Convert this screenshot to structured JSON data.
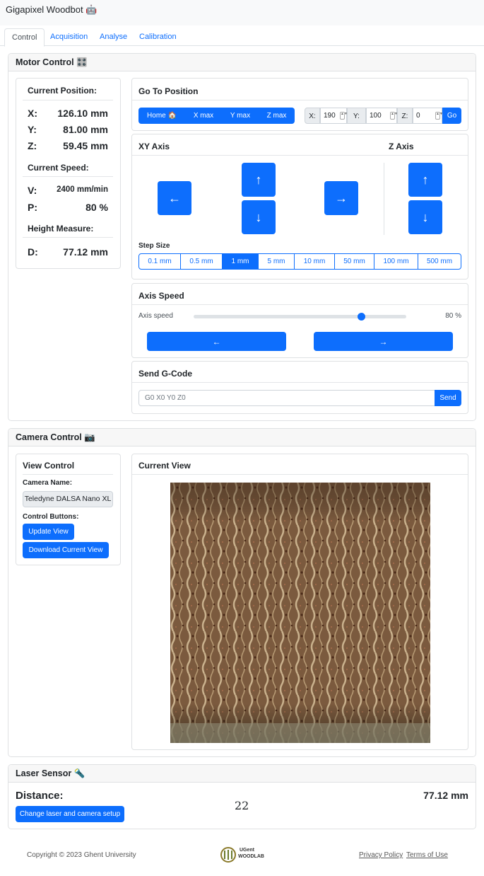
{
  "app": {
    "title": "Gigapixel Woodbot 🤖"
  },
  "tabs": [
    {
      "label": "Control",
      "active": true
    },
    {
      "label": "Acquisition",
      "active": false
    },
    {
      "label": "Analyse",
      "active": false
    },
    {
      "label": "Calibration",
      "active": false
    }
  ],
  "motor": {
    "title": "Motor Control 🎛️",
    "current_position": {
      "title": "Current Position:",
      "x_label": "X:",
      "x_value": "126.10 mm",
      "y_label": "Y:",
      "y_value": "81.00 mm",
      "z_label": "Z:",
      "z_value": "59.45 mm"
    },
    "current_speed": {
      "title": "Current Speed:",
      "v_label": "V:",
      "v_value": "2400 mm/min",
      "p_label": "P:",
      "p_value": "80 %"
    },
    "height_measure": {
      "title": "Height Measure:",
      "d_label": "D:",
      "d_value": "77.12 mm"
    },
    "goto": {
      "title": "Go To Position",
      "home_label": "Home 🏠",
      "xmax_label": "X max",
      "ymax_label": "Y max",
      "zmax_label": "Z max",
      "x_label": "X:",
      "x_value": "190",
      "y_label": "Y:",
      "y_value": "100",
      "z_label": "Z:",
      "z_value": "0",
      "go_label": "Go"
    },
    "xy_axis": {
      "title": "XY Axis",
      "left": "←",
      "up": "↑",
      "down": "↓",
      "right": "→"
    },
    "z_axis": {
      "title": "Z Axis",
      "up": "↑",
      "down": "↓"
    },
    "step_size": {
      "title": "Step Size",
      "options": [
        "0.1 mm",
        "0.5 mm",
        "1 mm",
        "5 mm",
        "10 mm",
        "50 mm",
        "100 mm",
        "500 mm"
      ],
      "selected": "1 mm"
    },
    "axis_speed": {
      "title": "Axis Speed",
      "label": "Axis speed",
      "value_text": "80 %",
      "value": 80,
      "left": "←",
      "right": "→"
    },
    "gcode": {
      "title": "Send G-Code",
      "placeholder": "G0 X0 Y0 Z0",
      "send_label": "Send"
    }
  },
  "camera": {
    "title": "Camera Control 📷",
    "view_control": {
      "title": "View Control",
      "camera_name_label": "Camera Name:",
      "camera_name": "Teledyne DALSA Nano XL",
      "control_buttons_label": "Control Buttons:",
      "update_label": "Update View",
      "download_label": "Download Current View"
    },
    "current_view": {
      "title": "Current View"
    }
  },
  "laser": {
    "title": "Laser Sensor 🔦",
    "distance_label": "Distance:",
    "distance_value": "77.12 mm",
    "change_label": "Change laser and camera setup",
    "page_number": "22"
  },
  "footer": {
    "copyright": "Copyright © 2023 Ghent University",
    "logo_text_1": "UGent",
    "logo_text_2": "WOODLAB",
    "privacy": "Privacy Policy",
    "terms": "Terms of Use"
  },
  "colors": {
    "accent": "#0d6efd",
    "border": "#dfe1e3"
  }
}
